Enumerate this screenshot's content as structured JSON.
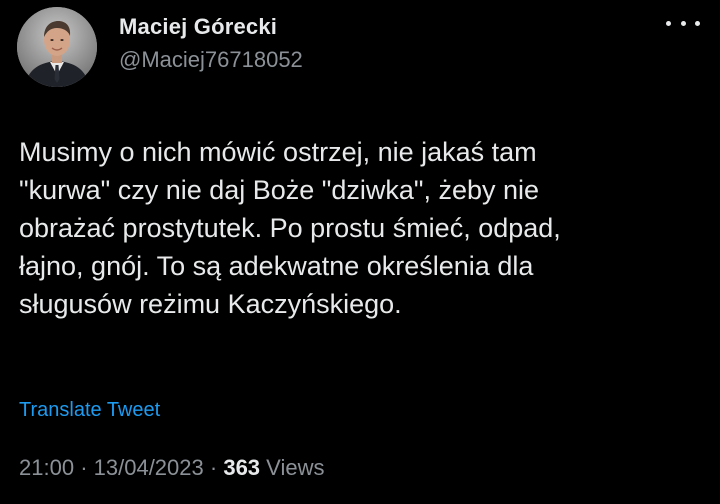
{
  "author": {
    "display_name": "Maciej Górecki",
    "handle": "@Maciej76718052"
  },
  "menu": {
    "icon": "more-horizontal-icon"
  },
  "tweet": {
    "lines": [
      "Musimy o nich mówić ostrzej, nie jakaś tam",
      "\"kurwa\" czy nie daj Boże \"dziwka\", żeby nie",
      "obrażać prostytutek. Po prostu śmieć, odpad,",
      "łajno, gnój. To są adekwatne określenia dla",
      "sługusów reżimu Kaczyńskiego."
    ],
    "translate_label": "Translate Tweet"
  },
  "meta": {
    "time": "21:00",
    "separator": "·",
    "date": "13/04/2023",
    "views_count": "363",
    "views_label": "Views"
  },
  "colors": {
    "background": "#000000",
    "primary_text": "#e7e9ea",
    "secondary_text": "#8b9197",
    "link": "#1d9bf0"
  }
}
